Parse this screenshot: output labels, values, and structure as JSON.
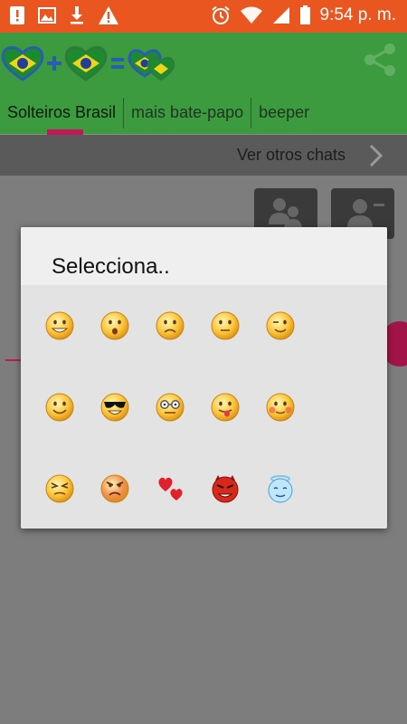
{
  "status_bar": {
    "left_icons": [
      "alert-box-icon",
      "image-icon",
      "download-icon",
      "warning-icon"
    ],
    "right_icons": [
      "alarm-icon",
      "wifi-icon",
      "signal-icon",
      "battery-icon"
    ],
    "time": "9:54 p. m."
  },
  "app_bar": {
    "logo_icons": [
      "brazil-heart-icon",
      "plus-icon",
      "brazil-heart-icon",
      "equals-icon",
      "brazil-hearts-pair-icon"
    ],
    "share_icon": "share-icon",
    "color": "#3d9b3f",
    "tabs": [
      {
        "label": "Solteiros Brasil"
      },
      {
        "label": "mais bate-papo"
      },
      {
        "label": "beeper"
      }
    ],
    "indicator_color": "#c2175b"
  },
  "banner": {
    "text": "Ver otros chats",
    "chevron_icon": "chevron-right-icon"
  },
  "actions": [
    {
      "icon": "group-users-icon"
    },
    {
      "icon": "remove-user-icon"
    }
  ],
  "dialog": {
    "title": "Selecciona..",
    "emoticons": [
      "grin-smiley-icon",
      "surprised-smiley-icon",
      "sad-smiley-icon",
      "neutral-smiley-icon",
      "wink-smiley-icon",
      "smile-smiley-icon",
      "cool-sunglasses-smiley-icon",
      "nerd-glasses-smiley-icon",
      "tongue-smiley-icon",
      "blush-smiley-icon",
      "squint-smiley-icon",
      "angry-smiley-icon",
      "hearts-icon",
      "devil-smiley-icon",
      "angel-smiley-icon"
    ]
  }
}
